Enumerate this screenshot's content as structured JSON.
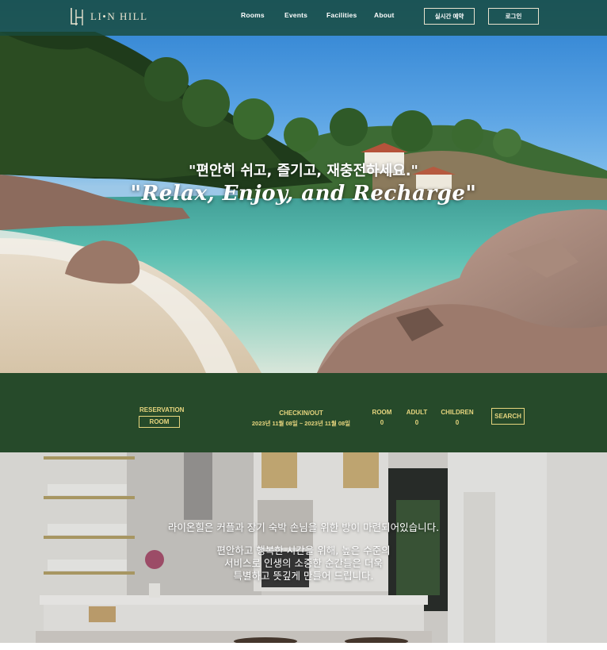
{
  "navbar": {
    "logo_mark": "LH",
    "logo_text": "LI•N HILL",
    "links": [
      "Rooms",
      "Events",
      "Facilities",
      "About"
    ],
    "realtime_booking": "실시간 예약",
    "login": "로그인"
  },
  "hero": {
    "title_kr": "\"편안히 쉬고, 즐기고, 재충전하세요.\"",
    "title_en": "\"Relax, Enjoy, and Recharge\""
  },
  "reservation": {
    "type_label": "RESERVATION",
    "type_value": "ROOM",
    "checkin_label": "CHECKIN/OUT",
    "checkin_value": "2023년 11월 08일 ~ 2023년 11월 08일",
    "room_label": "ROOM",
    "room_value": "0",
    "adult_label": "ADULT",
    "adult_value": "0",
    "children_label": "CHILDREN",
    "children_value": "0",
    "search": "SEARCH"
  },
  "room_section": {
    "line1": "라이온힐은 커플과 장기 숙박 손님을 위한 방이 마련되어있습니다.",
    "line2": "편안하고 행복한 시간을 위해, 높은 수준의",
    "line3": "서비스로 인생의 소중한 순간들은 더욱",
    "line4": "특별하고 뜻깊게 만들어 드립니다."
  },
  "colors": {
    "navbar": "#184a3a",
    "reservation_bar": "#264a2a",
    "gold": "#e6d57e",
    "cream": "#e8e3cf"
  }
}
